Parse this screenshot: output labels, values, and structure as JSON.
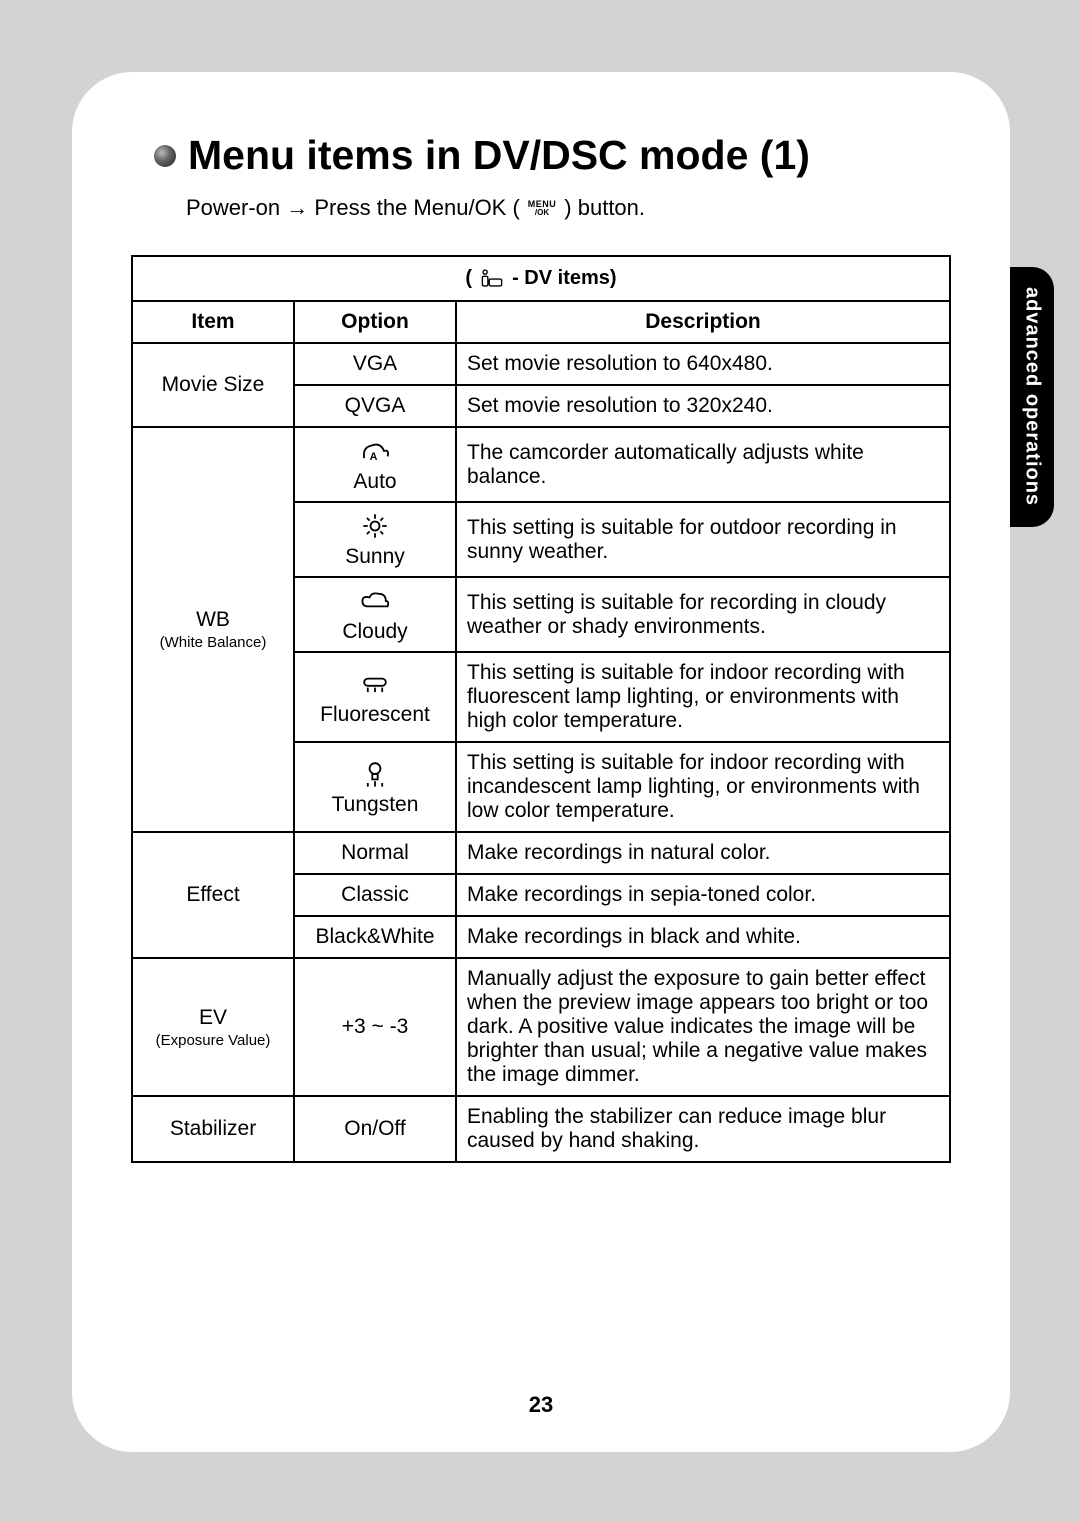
{
  "sideTab": "advanced operations",
  "title": "Menu items in DV/DSC mode (1)",
  "instruction": {
    "pre": "Power-on → Press the Menu/OK (",
    "post": ") button."
  },
  "tableCaption": " - DV items)",
  "headers": {
    "item": "Item",
    "option": "Option",
    "description": "Description"
  },
  "rows": {
    "movieSize": {
      "item": "Movie Size",
      "opts": [
        {
          "option": "VGA",
          "desc": "Set movie resolution to 640x480."
        },
        {
          "option": "QVGA",
          "desc": "Set movie resolution to 320x240."
        }
      ]
    },
    "wb": {
      "item": "WB",
      "itemSub": "(White Balance)",
      "opts": [
        {
          "option": "Auto",
          "desc": "The camcorder automatically adjusts white balance."
        },
        {
          "option": "Sunny",
          "desc": "This setting is suitable for outdoor recording in sunny weather."
        },
        {
          "option": "Cloudy",
          "desc": "This setting is suitable for recording in cloudy weather or shady environments."
        },
        {
          "option": "Fluorescent",
          "desc": "This setting is suitable for indoor recording with fluorescent lamp lighting, or environments with high color temperature."
        },
        {
          "option": "Tungsten",
          "desc": "This setting is suitable for indoor recording with incandescent lamp lighting, or environments with low color temperature."
        }
      ]
    },
    "effect": {
      "item": "Effect",
      "opts": [
        {
          "option": "Normal",
          "desc": "Make recordings in natural color."
        },
        {
          "option": "Classic",
          "desc": "Make recordings in sepia-toned color."
        },
        {
          "option": "Black&White",
          "desc": "Make recordings in black and white."
        }
      ]
    },
    "ev": {
      "item": "EV",
      "itemSub": "(Exposure Value)",
      "option": "+3 ~ -3",
      "desc": "Manually adjust the exposure to gain better effect when the preview image appears too bright or too dark. A positive value indicates the image will be brighter than usual; while a negative value makes the image dimmer."
    },
    "stabilizer": {
      "item": "Stabilizer",
      "option": "On/Off",
      "desc": "Enabling the stabilizer can reduce image blur caused by hand shaking."
    }
  },
  "pageNumber": "23"
}
